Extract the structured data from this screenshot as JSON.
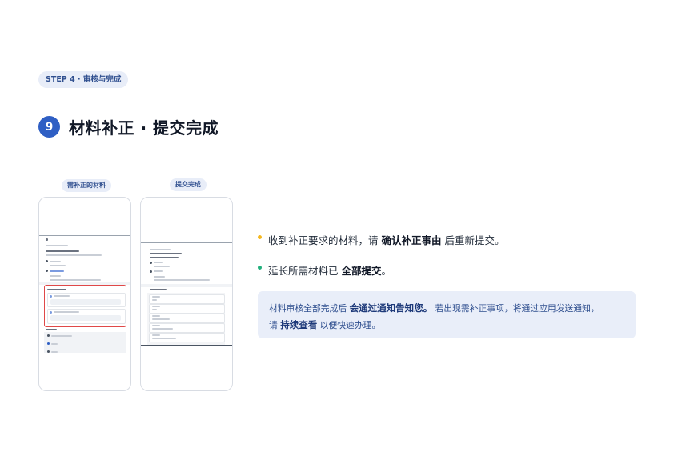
{
  "step_badge": "STEP 4 · 审核与完成",
  "step_number": "9",
  "title": "材料补正 · 提交完成",
  "phones": {
    "left_label": "需补正的材料",
    "right_label": "提交完成"
  },
  "bullets": [
    {
      "pre": "收到补正要求的材料，请",
      "bold": "确认补正事由",
      "post": "后重新提交。",
      "dot_color": "#f5b820"
    },
    {
      "pre": "延长所需材料已",
      "bold": "全部提交",
      "post": "。",
      "dot_color": "#22b07d"
    }
  ],
  "note": {
    "part1": "材料审核全部完成后",
    "bold1": "会通过通知告知您。",
    "part2": "若出现需补正事项，将通过应用发送通知，",
    "part3": "请",
    "bold2": "持续查看",
    "part4": "以便快速办理。"
  }
}
